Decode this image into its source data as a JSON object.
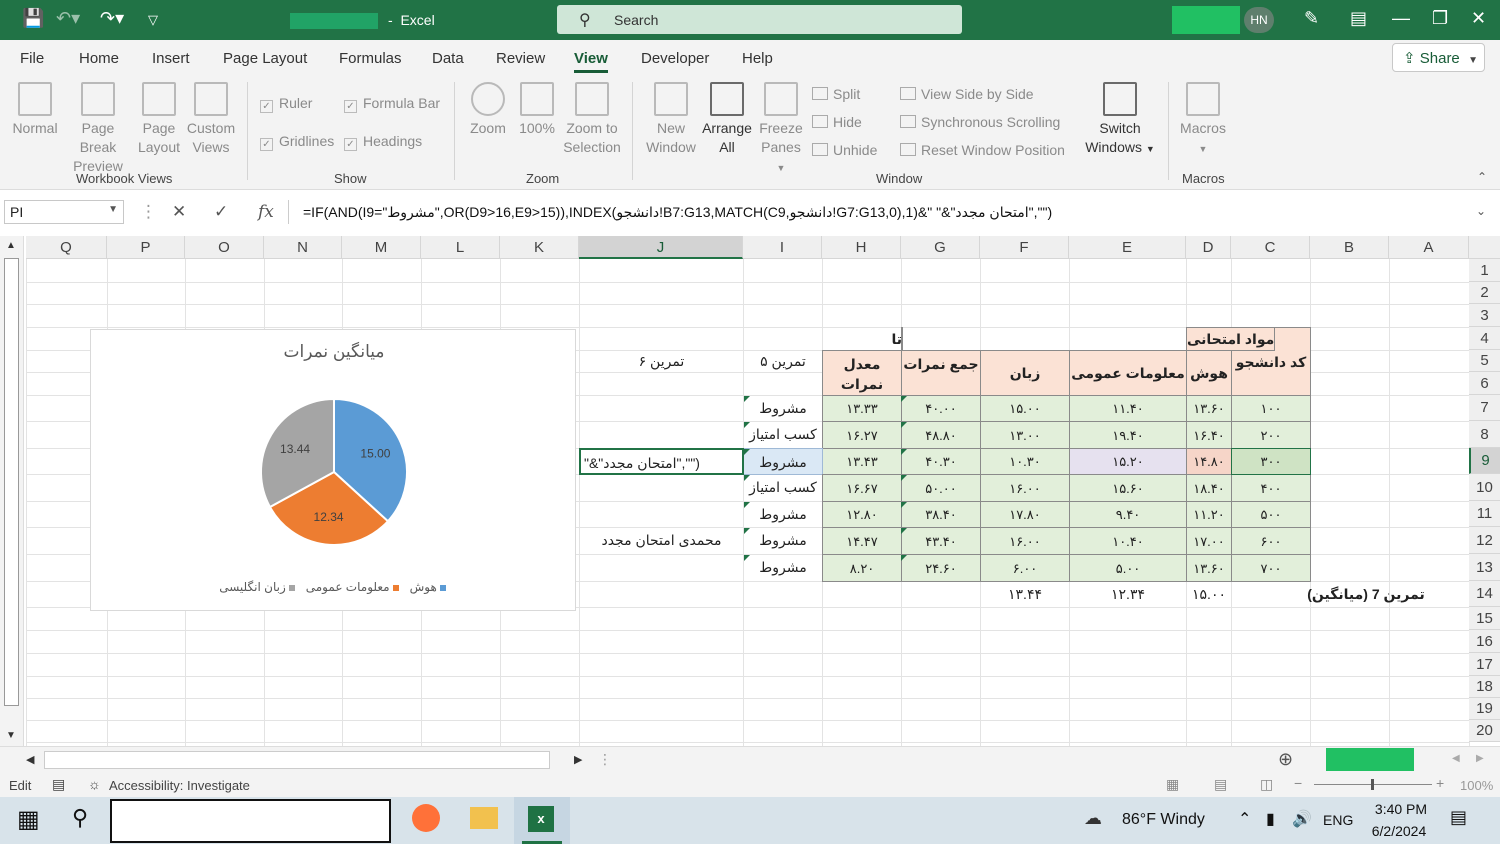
{
  "titlebar": {
    "title": "Excel",
    "title_sep": "-",
    "search_placeholder": "Search",
    "avatar": "HN"
  },
  "tabs": [
    "File",
    "Home",
    "Insert",
    "Page Layout",
    "Formulas",
    "Data",
    "Review",
    "View",
    "Developer",
    "Help"
  ],
  "active_tab": "View",
  "share_label": "Share",
  "ribbon": {
    "workbook_views": {
      "group": "Workbook Views",
      "normal": "Normal",
      "page_break_1": "Page Break",
      "page_break_2": "Preview",
      "page_layout_1": "Page",
      "page_layout_2": "Layout",
      "custom_1": "Custom",
      "custom_2": "Views"
    },
    "show": {
      "group": "Show",
      "ruler": "Ruler",
      "formula_bar": "Formula Bar",
      "gridlines": "Gridlines",
      "headings": "Headings"
    },
    "zoom": {
      "group": "Zoom",
      "zoom": "Zoom",
      "hundred": "100%",
      "zoom_sel_1": "Zoom to",
      "zoom_sel_2": "Selection"
    },
    "window": {
      "group": "Window",
      "new_1": "New",
      "new_2": "Window",
      "arrange_1": "Arrange",
      "arrange_2": "All",
      "freeze_1": "Freeze",
      "freeze_2": "Panes",
      "split": "Split",
      "hide": "Hide",
      "unhide": "Unhide",
      "side_by_side": "View Side by Side",
      "sync_scroll": "Synchronous Scrolling",
      "reset_pos": "Reset Window Position",
      "switch_1": "Switch",
      "switch_2": "Windows"
    },
    "macros": {
      "group": "Macros",
      "macros": "Macros"
    }
  },
  "formula_bar": {
    "name_box": "PI",
    "formula": "=IF(AND(I9=\"مشروط\",OR(D9>16,E9>15)),INDEX(دانشجو!B7:G13,MATCH(C9,دانشجو!G7:G13,0),1)&\" \"&\"امتحان مجدد\",\"\")"
  },
  "columns": [
    "Q",
    "P",
    "O",
    "N",
    "M",
    "L",
    "K",
    "J",
    "I",
    "H",
    "G",
    "F",
    "E",
    "D",
    "C",
    "B",
    "A"
  ],
  "rows": [
    "1",
    "2",
    "3",
    "4",
    "5",
    "6",
    "7",
    "8",
    "9",
    "10",
    "11",
    "12",
    "13",
    "14",
    "15",
    "16",
    "17",
    "18",
    "19",
    "20"
  ],
  "table": {
    "header_group_exam": "مواد امتحانی",
    "header_group_two_dec": "تا دو رقم اعشار",
    "col_student_code": "کد دانشجو",
    "col_iq": "هوش",
    "col_general": "معلومات عمومی",
    "col_english": "زبان انگلیسی",
    "col_sum": "جمع نمرات",
    "col_avg": "معدل نمرات",
    "ex5": "تمرین ۵",
    "ex6": "تمرین ۶",
    "rows": [
      {
        "code": "۱۰۰",
        "iq": "۱۳.۶۰",
        "gen": "۱۱.۴۰",
        "eng": "۱۵.۰۰",
        "sum": "۴۰.۰۰",
        "avg": "۱۳.۳۳",
        "status": "مشروط",
        "ex6": ""
      },
      {
        "code": "۲۰۰",
        "iq": "۱۶.۴۰",
        "gen": "۱۹.۴۰",
        "eng": "۱۳.۰۰",
        "sum": "۴۸.۸۰",
        "avg": "۱۶.۲۷",
        "status": "کسب امتیاز",
        "ex6": ""
      },
      {
        "code": "۳۰۰",
        "iq": "۱۴.۸۰",
        "gen": "۱۵.۲۰",
        "eng": "۱۰.۳۰",
        "sum": "۴۰.۳۰",
        "avg": "۱۳.۴۳",
        "status": "مشروط",
        "ex6": "\"&\"امتحان مجدد\",\"\")"
      },
      {
        "code": "۴۰۰",
        "iq": "۱۸.۴۰",
        "gen": "۱۵.۶۰",
        "eng": "۱۶.۰۰",
        "sum": "۵۰.۰۰",
        "avg": "۱۶.۶۷",
        "status": "کسب امتیاز",
        "ex6": ""
      },
      {
        "code": "۵۰۰",
        "iq": "۱۱.۲۰",
        "gen": "۹.۴۰",
        "eng": "۱۷.۸۰",
        "sum": "۳۸.۴۰",
        "avg": "۱۲.۸۰",
        "status": "مشروط",
        "ex6": ""
      },
      {
        "code": "۶۰۰",
        "iq": "۱۷.۰۰",
        "gen": "۱۰.۴۰",
        "eng": "۱۶.۰۰",
        "sum": "۴۳.۴۰",
        "avg": "۱۴.۴۷",
        "status": "مشروط",
        "ex6": "محمدی امتحان مجدد"
      },
      {
        "code": "۷۰۰",
        "iq": "۱۳.۶۰",
        "gen": "۵.۰۰",
        "eng": "۶.۰۰",
        "sum": "۲۴.۶۰",
        "avg": "۸.۲۰",
        "status": "مشروط",
        "ex6": ""
      }
    ],
    "avg_row": {
      "label": "تمرین 7 (میانگین)",
      "iq": "۱۵.۰۰",
      "gen": "۱۲.۳۴",
      "eng": "۱۳.۴۴"
    }
  },
  "chart_data": {
    "type": "pie",
    "title": "میانگین نمرات",
    "categories": [
      "هوش",
      "معلومات عمومی",
      "زبان انگلیسی"
    ],
    "values": [
      15.0,
      12.34,
      13.44
    ],
    "labels": [
      "15.00",
      "12.34",
      "13.44"
    ],
    "colors": [
      "#5b9bd5",
      "#ed7d31",
      "#a5a5a5"
    ],
    "legend": "bottom"
  },
  "status": {
    "mode": "Edit",
    "accessibility": "Accessibility: Investigate",
    "zoom": "100%"
  },
  "taskbar": {
    "weather": "86°F  Windy",
    "lang": "ENG",
    "time": "3:40 PM",
    "date": "6/2/2024"
  }
}
